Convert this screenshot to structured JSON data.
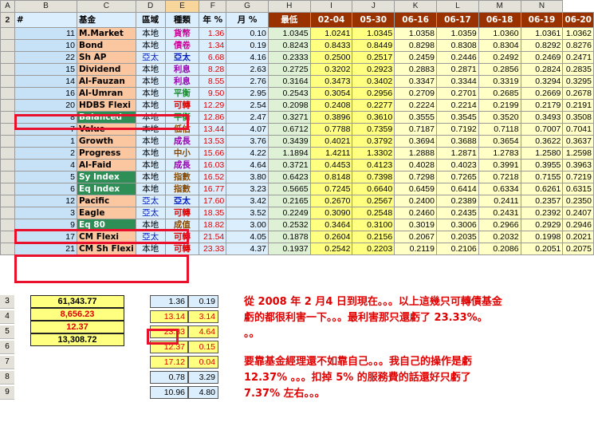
{
  "columns": [
    "A",
    "B",
    "C",
    "D",
    "E",
    "F",
    "G",
    "H",
    "I",
    "J",
    "K",
    "L",
    "M",
    "N"
  ],
  "header": {
    "row": "2",
    "num": "#",
    "fund": "基金",
    "region": "區域",
    "type": "種類",
    "year": "年 %",
    "month": "月 %",
    "low": "最低",
    "dates": [
      "02-04",
      "05-30",
      "06-16",
      "06-17",
      "06-18",
      "06-19",
      "06-20"
    ]
  },
  "rows": [
    {
      "r": "11",
      "fund": "M.Market",
      "loc": "本地",
      "typ": "貨幣",
      "tc": "c-magenta",
      "fbg": "bg-peach",
      "y": "1.36",
      "m": "0.10",
      "low": "1.0345",
      "d": [
        "1.0241",
        "1.0345",
        "1.0358",
        "1.0359",
        "1.0360",
        "1.0361",
        "1.0362"
      ]
    },
    {
      "r": "10",
      "fund": "Bond",
      "loc": "本地",
      "typ": "債卷",
      "tc": "c-magenta",
      "fbg": "bg-peach",
      "y": "1.34",
      "m": "0.19",
      "low": "0.8243",
      "d": [
        "0.8433",
        "0.8449",
        "0.8298",
        "0.8308",
        "0.8304",
        "0.8292",
        "0.8276"
      ]
    },
    {
      "r": "22",
      "fund": "Sh AP",
      "loc": "亞太",
      "typ": "亞太",
      "tc": "c-blue",
      "lc": "c-blue",
      "fbg": "bg-peach",
      "y": "6.68",
      "m": "4.16",
      "low": "0.2333",
      "d": [
        "0.2500",
        "0.2517",
        "0.2459",
        "0.2446",
        "0.2492",
        "0.2469",
        "0.2471"
      ]
    },
    {
      "r": "15",
      "fund": "Dividend",
      "loc": "本地",
      "typ": "利息",
      "tc": "c-purple",
      "fbg": "bg-peach",
      "y": "8.28",
      "m": "2.63",
      "low": "0.2725",
      "d": [
        "0.3202",
        "0.2923",
        "0.2883",
        "0.2871",
        "0.2856",
        "0.2824",
        "0.2835"
      ]
    },
    {
      "r": "14",
      "fund": "Al-Fauzan",
      "loc": "本地",
      "typ": "利息",
      "tc": "c-purple",
      "fbg": "bg-peach",
      "y": "8.55",
      "m": "2.76",
      "low": "0.3164",
      "d": [
        "0.3473",
        "0.3402",
        "0.3347",
        "0.3344",
        "0.3319",
        "0.3294",
        "0.3295"
      ]
    },
    {
      "r": "16",
      "fund": "Al-Umran",
      "loc": "本地",
      "typ": "平衡",
      "tc": "c-green",
      "fbg": "bg-peach",
      "y": "9.50",
      "m": "2.95",
      "low": "0.2543",
      "d": [
        "0.3054",
        "0.2956",
        "0.2709",
        "0.2701",
        "0.2685",
        "0.2669",
        "0.2678"
      ]
    },
    {
      "r": "20",
      "fund": "HDBS Flexi",
      "loc": "本地",
      "typ": "可轉",
      "tc": "c-red",
      "fbg": "bg-peach",
      "y": "12.29",
      "m": "2.54",
      "low": "0.2098",
      "d": [
        "0.2408",
        "0.2277",
        "0.2224",
        "0.2214",
        "0.2199",
        "0.2179",
        "0.2191"
      ]
    },
    {
      "r": "8",
      "fund": "Balanced",
      "loc": "本地",
      "typ": "平衡",
      "tc": "c-green",
      "fbg": "bg-dkgreen",
      "y": "12.86",
      "m": "2.47",
      "low": "0.3271",
      "d": [
        "0.3896",
        "0.3610",
        "0.3555",
        "0.3545",
        "0.3520",
        "0.3493",
        "0.3508"
      ]
    },
    {
      "r": "7",
      "fund": "Value",
      "loc": "本地",
      "typ": "低估",
      "tc": "c-brown",
      "fbg": "bg-peach",
      "y": "13.44",
      "m": "4.07",
      "low": "0.6712",
      "d": [
        "0.7788",
        "0.7359",
        "0.7187",
        "0.7192",
        "0.7118",
        "0.7007",
        "0.7041"
      ]
    },
    {
      "r": "1",
      "fund": "Growth",
      "loc": "本地",
      "typ": "成長",
      "tc": "c-purple",
      "fbg": "bg-peach",
      "y": "13.53",
      "m": "3.76",
      "low": "0.3439",
      "d": [
        "0.4021",
        "0.3792",
        "0.3694",
        "0.3688",
        "0.3654",
        "0.3622",
        "0.3637"
      ]
    },
    {
      "r": "2",
      "fund": "Progress",
      "loc": "本地",
      "typ": "中小",
      "tc": "c-brown",
      "fbg": "bg-peach",
      "y": "15.66",
      "m": "4.22",
      "low": "1.1894",
      "d": [
        "1.4211",
        "1.3302",
        "1.2888",
        "1.2871",
        "1.2783",
        "1.2580",
        "1.2598"
      ]
    },
    {
      "r": "4",
      "fund": "Al-Faid",
      "loc": "本地",
      "typ": "成長",
      "tc": "c-purple",
      "fbg": "bg-peach",
      "y": "16.03",
      "m": "4.64",
      "low": "0.3721",
      "d": [
        "0.4453",
        "0.4123",
        "0.4028",
        "0.4023",
        "0.3991",
        "0.3955",
        "0.3963"
      ]
    },
    {
      "r": "5",
      "fund": "Sy Index",
      "loc": "本地",
      "typ": "指數",
      "tc": "c-brown",
      "fbg": "bg-dkgreen",
      "y": "16.52",
      "m": "3.80",
      "low": "0.6423",
      "d": [
        "0.8148",
        "0.7398",
        "0.7298",
        "0.7265",
        "0.7218",
        "0.7155",
        "0.7219"
      ]
    },
    {
      "r": "6",
      "fund": "Eq Index",
      "loc": "本地",
      "typ": "指數",
      "tc": "c-brown",
      "fbg": "bg-dkgreen",
      "y": "16.77",
      "m": "3.23",
      "low": "0.5665",
      "d": [
        "0.7245",
        "0.6640",
        "0.6459",
        "0.6414",
        "0.6334",
        "0.6261",
        "0.6315"
      ]
    },
    {
      "r": "12",
      "fund": "Pacific",
      "loc": "亞太",
      "typ": "亞太",
      "tc": "c-blue",
      "lc": "c-blue",
      "fbg": "bg-peach",
      "y": "17.60",
      "m": "3.42",
      "low": "0.2165",
      "d": [
        "0.2670",
        "0.2567",
        "0.2400",
        "0.2389",
        "0.2411",
        "0.2357",
        "0.2350"
      ]
    },
    {
      "r": "3",
      "fund": "Eagle",
      "loc": "亞太",
      "typ": "可轉",
      "tc": "c-red",
      "lc": "c-blue",
      "fbg": "bg-peach",
      "y": "18.35",
      "m": "3.52",
      "low": "0.2249",
      "d": [
        "0.3090",
        "0.2548",
        "0.2460",
        "0.2435",
        "0.2431",
        "0.2392",
        "0.2407"
      ]
    },
    {
      "r": "9",
      "fund": "Eq 80",
      "loc": "本地",
      "typ": "成值",
      "tc": "c-brown",
      "fbg": "bg-dkgreen",
      "y": "18.82",
      "m": "3.00",
      "low": "0.2532",
      "d": [
        "0.3464",
        "0.3100",
        "0.3019",
        "0.3006",
        "0.2966",
        "0.2929",
        "0.2946"
      ]
    },
    {
      "r": "17",
      "fund": "CM Flexi",
      "loc": "亞太",
      "typ": "可轉",
      "tc": "c-red",
      "lc": "c-blue",
      "fbg": "bg-peach",
      "y": "21.54",
      "m": "4.05",
      "low": "0.1878",
      "d": [
        "0.2604",
        "0.2156",
        "0.2067",
        "0.2035",
        "0.2032",
        "0.1998",
        "0.2021"
      ]
    },
    {
      "r": "21",
      "fund": "CM Sh Flexi",
      "loc": "本地",
      "typ": "可轉",
      "tc": "c-red",
      "fbg": "bg-peach",
      "y": "23.33",
      "m": "4.37",
      "low": "0.1937",
      "d": [
        "0.2542",
        "0.2203",
        "0.2119",
        "0.2106",
        "0.2086",
        "0.2051",
        "0.2075"
      ]
    }
  ],
  "summary": {
    "row_nums": [
      "3",
      "4",
      "5",
      "6",
      "7",
      "8",
      "9"
    ],
    "left": [
      "61,343.77",
      "8,656.23",
      "12.37",
      "13,308.72"
    ],
    "year": [
      "1.36",
      "13.14",
      "23.33",
      "12.37",
      "17.12",
      "0.78",
      "10.96"
    ],
    "month": [
      "0.19",
      "3.14",
      "4.64",
      "0.15",
      "0.04",
      "3.29",
      "4.80"
    ]
  },
  "notes": {
    "line1": "從 2008 年 2 月4 日到現在。。。以上這幾只可轉債基金",
    "line2": "虧的都很利害一下。。。最利害那只還虧了 23.33%。",
    "line3": "。。",
    "line4": "要靠基金經理還不如靠自己。。。我自己的操作是虧",
    "line5": "12.37% 。。。扣掉 5% 的服務費的話還好只虧了",
    "line6": "7.37% 左右。。。"
  }
}
